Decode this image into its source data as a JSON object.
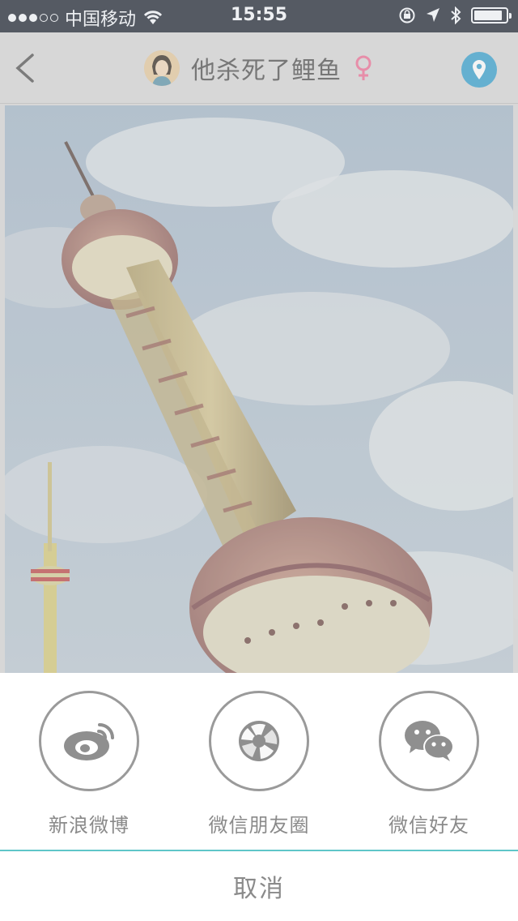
{
  "status_bar": {
    "carrier": "中国移动",
    "time": "15:55",
    "battery_level": 0.9,
    "signal_bars_filled": 3,
    "signal_bars_total": 5
  },
  "nav": {
    "title": "他杀死了鲤鱼",
    "back_icon": "chevron-left-icon",
    "gender_icon": "female-icon",
    "location_icon": "location-pin-icon",
    "accent_color": "#4aa9d3",
    "gender_color": "#f07ea0"
  },
  "share_sheet": {
    "options": [
      {
        "label": "新浪微博",
        "icon": "weibo-icon"
      },
      {
        "label": "微信朋友圈",
        "icon": "wechat-moments-icon"
      },
      {
        "label": "微信好友",
        "icon": "wechat-icon"
      }
    ],
    "cancel_label": "取消",
    "divider_color": "#5fc6c9"
  }
}
